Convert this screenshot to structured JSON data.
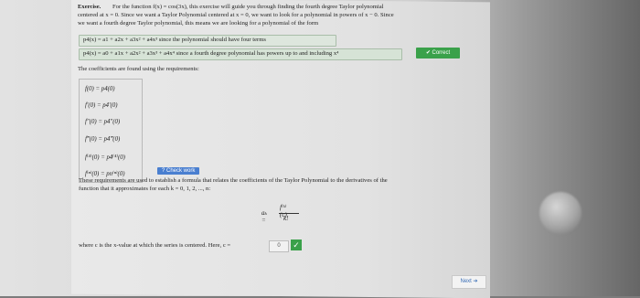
{
  "intro": {
    "line1_label": "Exercise.",
    "line1_text": "For the function f(x) = cos(3x), this exercise will guide you through finding the fourth degree Taylor polynomial",
    "line2": "centered at x = 0. Since we want a Taylor Polynomial centered at x = 0, we want to look for a polynomial in powers of x − 0. Since",
    "line3": "we want a fourth degree Taylor polynomial, this means we are looking for a polynomial of the form"
  },
  "choices": [
    {
      "text": "p4(x) = a1 + a2x + a3x² + a4x³ since the polynomial should have four terms"
    },
    {
      "text": "p4(x) = a0 + a1x + a2x² + a3x³ + a4x⁴ since a fourth degree polynomial has powers up to and including x⁴"
    }
  ],
  "correct_label": "✔ Correct",
  "requirements_text": "The coefficients are found using the requirements:",
  "requirements": [
    {
      "text": "f(0) = p4(0)"
    },
    {
      "text": "f′(0) = p4′(0)"
    },
    {
      "text": "f″(0) = p4″(0)"
    },
    {
      "text": "f‴(0) = p4‴(0)"
    },
    {
      "text": "f⁽⁴⁾(0) = p4⁽⁴⁾(0)"
    },
    {
      "text": "f⁽ⁿ⁾(0) = pn⁽ⁿ⁾(0)"
    }
  ],
  "check_work_label": "? Check work",
  "formula_text1": "These requirements are used to establish a formula that relates the coefficients of the Taylor Polynomial to the derivatives of the",
  "formula_text2": "function that it approximates for each k = 0, 1, 2, ..., n:",
  "formula": {
    "lhs": "aₖ =",
    "numerator": "f⁽ᵏ⁾(c)",
    "denominator": "k!"
  },
  "where_text": "where c is the x-value at which the series is centered. Here, c =",
  "c_value": "0",
  "check_icon": "check-icon",
  "next_label": "Next ➔"
}
